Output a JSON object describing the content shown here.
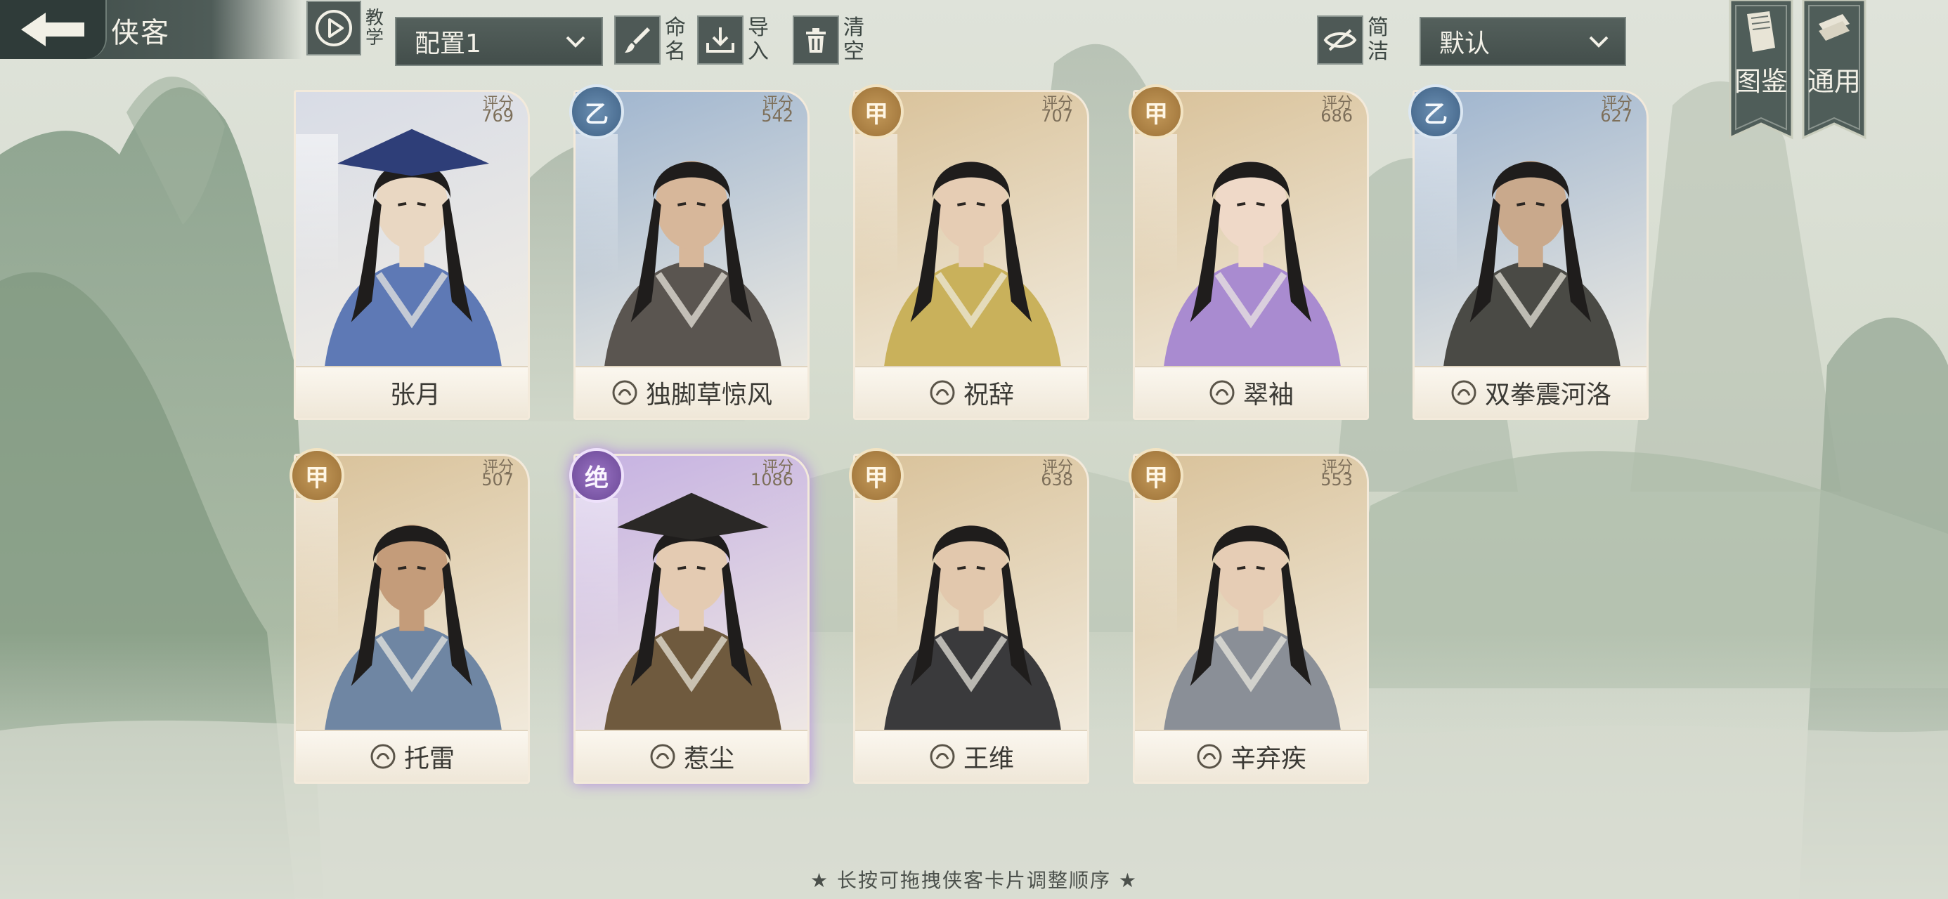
{
  "header": {
    "title": "侠客",
    "tutorial_label": "教学",
    "config_select": "配置1",
    "rename_label": "命名",
    "import_label": "导入",
    "clear_label": "清空",
    "simple_label": "简洁",
    "sort_select": "默认",
    "atlas_label": "图鉴",
    "general_label": "通用"
  },
  "score_label": "评分",
  "cards": [
    {
      "name": "张月",
      "score": "769",
      "grade": "",
      "tier": "none",
      "accent": "#d8dce6"
    },
    {
      "name": "独脚草惊风",
      "score": "542",
      "grade": "乙",
      "tier": "yi",
      "accent": "#9fb5cf"
    },
    {
      "name": "祝辞",
      "score": "707",
      "grade": "甲",
      "tier": "jia",
      "accent": "#d9c29a"
    },
    {
      "name": "翠袖",
      "score": "686",
      "grade": "甲",
      "tier": "jia",
      "accent": "#d9c29a"
    },
    {
      "name": "双拳震河洛",
      "score": "627",
      "grade": "乙",
      "tier": "yi",
      "accent": "#9fb5cf"
    },
    {
      "name": "托雷",
      "score": "507",
      "grade": "甲",
      "tier": "jia",
      "accent": "#d9c29a"
    },
    {
      "name": "惹尘",
      "score": "1086",
      "grade": "绝",
      "tier": "jue",
      "accent": "#c6b2e2"
    },
    {
      "name": "王维",
      "score": "638",
      "grade": "甲",
      "tier": "jia",
      "accent": "#d9c29a"
    },
    {
      "name": "辛弃疾",
      "score": "553",
      "grade": "甲",
      "tier": "jia",
      "accent": "#d9c29a"
    }
  ],
  "footer": {
    "hint": "★ 长按可拖拽侠客卡片调整顺序 ★"
  }
}
